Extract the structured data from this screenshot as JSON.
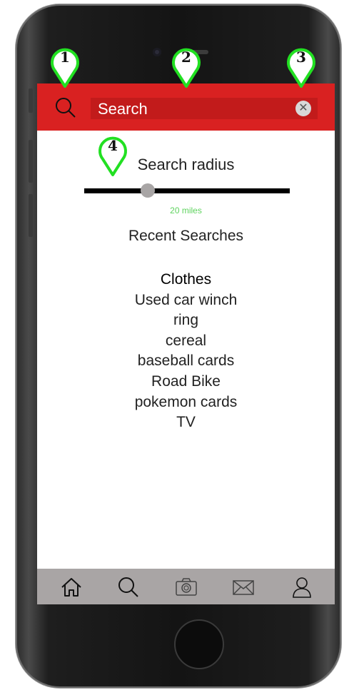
{
  "search": {
    "placeholder": "Search",
    "clear_icon": "close-icon"
  },
  "radius": {
    "label": "Search radius",
    "value_text": "20 miles",
    "level": 0.31
  },
  "recent": {
    "title": "Recent Searches",
    "items": [
      "Clothes",
      "Used car winch",
      "ring",
      "cereal",
      "baseball cards",
      "Road Bike",
      "pokemon cards",
      "TV"
    ]
  },
  "tabs": [
    {
      "name": "home",
      "icon": "home-icon"
    },
    {
      "name": "search",
      "icon": "search-icon"
    },
    {
      "name": "camera",
      "icon": "camera-icon"
    },
    {
      "name": "messages",
      "icon": "mail-icon"
    },
    {
      "name": "profile",
      "icon": "user-icon"
    }
  ],
  "annotations": [
    "1",
    "2",
    "3",
    "4"
  ],
  "colors": {
    "header": "#d92121",
    "tab_bar": "#a9a5a5",
    "accent_green": "#5ed35e",
    "marker_green": "#22e022"
  }
}
